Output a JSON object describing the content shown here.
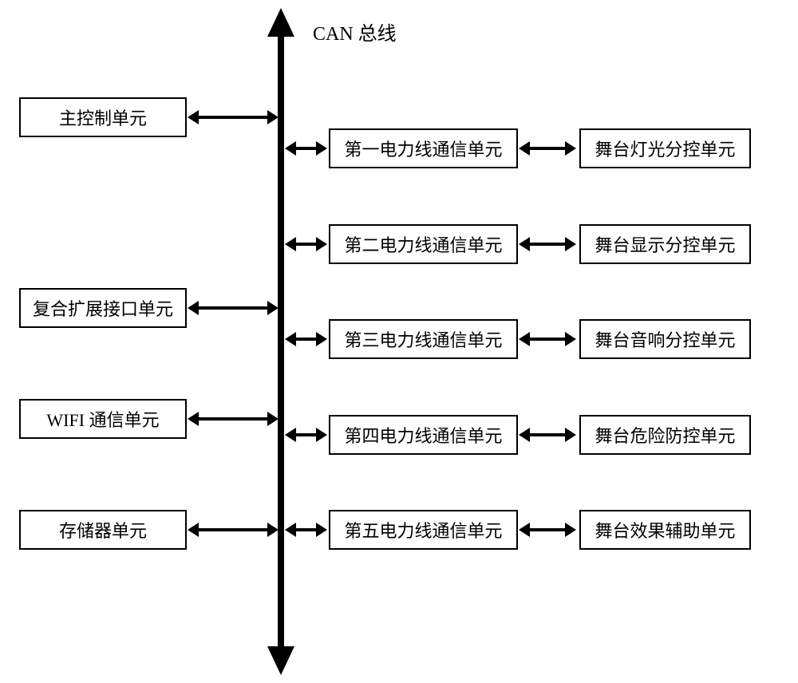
{
  "bus_label": "CAN 总线",
  "left_boxes": [
    {
      "label": "主控制单元"
    },
    {
      "label": "复合扩展接口单元"
    },
    {
      "label": "WIFI 通信单元"
    },
    {
      "label": "存储器单元"
    }
  ],
  "right_rows": [
    {
      "mid": "第一电力线通信单元",
      "right": "舞台灯光分控单元"
    },
    {
      "mid": "第二电力线通信单元",
      "right": "舞台显示分控单元"
    },
    {
      "mid": "第三电力线通信单元",
      "right": "舞台音响分控单元"
    },
    {
      "mid": "第四电力线通信单元",
      "right": "舞台危险防控单元"
    },
    {
      "mid": "第五电力线通信单元",
      "right": "舞台效果辅助单元"
    }
  ]
}
